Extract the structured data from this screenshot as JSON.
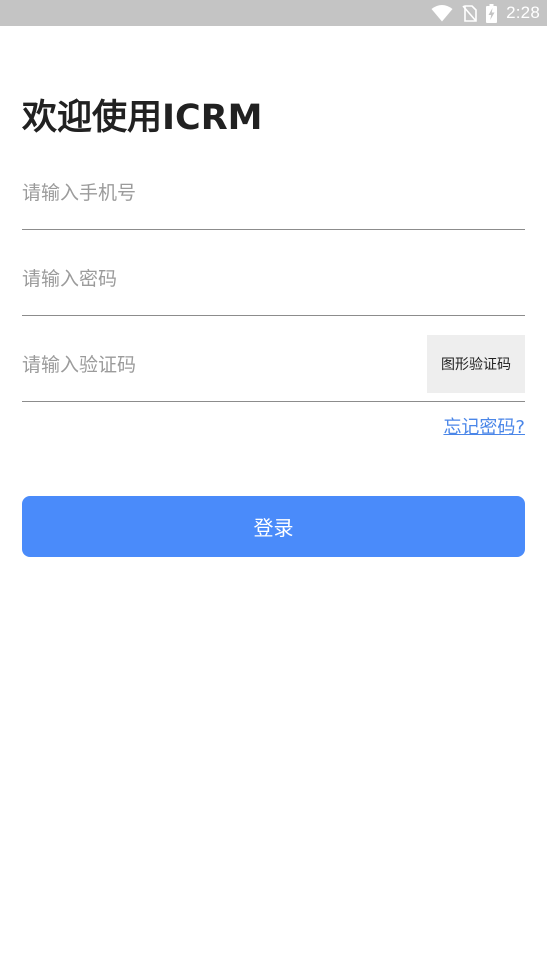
{
  "status_bar": {
    "time": "2:28",
    "icons": [
      "wifi-icon",
      "no-sim-icon",
      "battery-charging-icon"
    ]
  },
  "login": {
    "title": "欢迎使用ICRM",
    "phone_placeholder": "请输入手机号",
    "password_placeholder": "请输入密码",
    "captcha_placeholder": "请输入验证码",
    "captcha_image_label": "图形验证码",
    "forgot_password_label": "忘记密码?",
    "login_button_label": "登录"
  },
  "colors": {
    "status_bar_bg": "#c4c4c4",
    "primary_button": "#4a8bfa",
    "link": "#4a86e8",
    "title_text": "#212121",
    "placeholder_text": "#9b9b9b",
    "captcha_bg": "#eeeeee"
  }
}
